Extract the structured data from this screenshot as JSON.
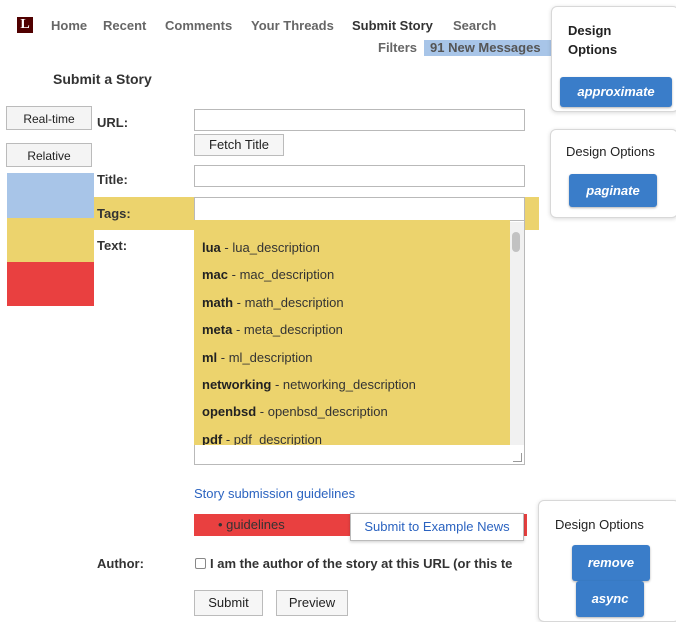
{
  "logo": "L",
  "nav": {
    "home": "Home",
    "recent": "Recent",
    "comments": "Comments",
    "threads": "Your Threads",
    "submit": "Submit Story",
    "search": "Search",
    "filters": "Filters",
    "messages": "91 New Messages"
  },
  "page_title": "Submit a Story",
  "side": {
    "realtime": "Real-time",
    "relative": "Relative"
  },
  "side_colors": [
    "#a8c5e8",
    "#ecd36d",
    "#e94040"
  ],
  "form": {
    "url_label": "URL:",
    "url_value": "",
    "fetch_title": "Fetch Title",
    "title_label": "Title:",
    "title_value": "",
    "tags_label": "Tags:",
    "text_label": "Text:",
    "guidelines_link": "Story submission guidelines",
    "guideline_bullet": "guidelines",
    "submit_to": "Submit to Example News",
    "author_label": "Author:",
    "author_checkbox": "I am the author of the story at this URL (or this te",
    "submit": "Submit",
    "preview": "Preview"
  },
  "tags": [
    {
      "name": "lua",
      "desc": " - lua_description"
    },
    {
      "name": "mac",
      "desc": " - mac_description"
    },
    {
      "name": "math",
      "desc": " - math_description"
    },
    {
      "name": "meta",
      "desc": " - meta_description"
    },
    {
      "name": "ml",
      "desc": " - ml_description"
    },
    {
      "name": "networking",
      "desc": " - networking_description"
    },
    {
      "name": "openbsd",
      "desc": " - openbsd_description"
    },
    {
      "name": "pdf",
      "desc": " - pdf_description"
    }
  ],
  "design_panels": [
    {
      "title": "Design\nOptions",
      "buttons": [
        "approximate"
      ]
    },
    {
      "title": "Design Options",
      "buttons": [
        "paginate"
      ]
    },
    {
      "title": "Design Options",
      "buttons": [
        "remove",
        "async"
      ]
    }
  ]
}
